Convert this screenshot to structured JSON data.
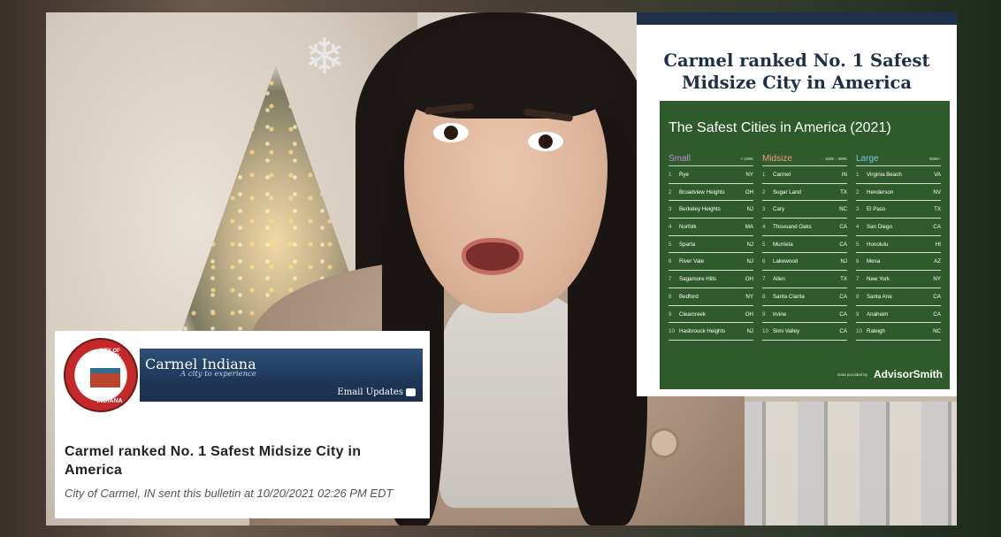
{
  "right_card": {
    "headline_line1": "Carmel ranked No. 1 Safest",
    "headline_line2": "Midsize City in America",
    "chart_title": "The Safest Cities in America (2021)",
    "columns": [
      {
        "name": "Small",
        "range": "< 100K",
        "rows": [
          {
            "rank": "1",
            "city": "Rye",
            "state": "NY"
          },
          {
            "rank": "2",
            "city": "Broadview Heights",
            "state": "OH"
          },
          {
            "rank": "3",
            "city": "Berkeley Heights",
            "state": "NJ"
          },
          {
            "rank": "4",
            "city": "Norfolk",
            "state": "MA"
          },
          {
            "rank": "5",
            "city": "Sparta",
            "state": "NJ"
          },
          {
            "rank": "6",
            "city": "River Vale",
            "state": "NJ"
          },
          {
            "rank": "7",
            "city": "Sagamore Hills",
            "state": "OH"
          },
          {
            "rank": "8",
            "city": "Bedford",
            "state": "NY"
          },
          {
            "rank": "9",
            "city": "Clearcreek",
            "state": "OH"
          },
          {
            "rank": "10",
            "city": "Hasbrouck Heights",
            "state": "NJ"
          }
        ]
      },
      {
        "name": "Midsize",
        "range": "100K - 300K",
        "rows": [
          {
            "rank": "1",
            "city": "Carmel",
            "state": "IN"
          },
          {
            "rank": "2",
            "city": "Sugar Land",
            "state": "TX"
          },
          {
            "rank": "3",
            "city": "Cary",
            "state": "NC"
          },
          {
            "rank": "4",
            "city": "Thousand Oaks",
            "state": "CA"
          },
          {
            "rank": "5",
            "city": "Murrieta",
            "state": "CA"
          },
          {
            "rank": "6",
            "city": "Lakewood",
            "state": "NJ"
          },
          {
            "rank": "7",
            "city": "Allen",
            "state": "TX"
          },
          {
            "rank": "8",
            "city": "Santa Clarita",
            "state": "CA"
          },
          {
            "rank": "9",
            "city": "Irvine",
            "state": "CA"
          },
          {
            "rank": "10",
            "city": "Simi Valley",
            "state": "CA"
          }
        ]
      },
      {
        "name": "Large",
        "range": "300K+",
        "rows": [
          {
            "rank": "1",
            "city": "Virginia Beach",
            "state": "VA"
          },
          {
            "rank": "2",
            "city": "Henderson",
            "state": "NV"
          },
          {
            "rank": "3",
            "city": "El Paso",
            "state": "TX"
          },
          {
            "rank": "4",
            "city": "San Diego",
            "state": "CA"
          },
          {
            "rank": "5",
            "city": "Honolulu",
            "state": "HI"
          },
          {
            "rank": "6",
            "city": "Mesa",
            "state": "AZ"
          },
          {
            "rank": "7",
            "city": "New York",
            "state": "NY"
          },
          {
            "rank": "8",
            "city": "Santa Ana",
            "state": "CA"
          },
          {
            "rank": "9",
            "city": "Anaheim",
            "state": "CA"
          },
          {
            "rank": "10",
            "city": "Raleigh",
            "state": "NC"
          }
        ]
      }
    ],
    "footer_small": "Data provided by",
    "footer_brand": "AdvisorSmith"
  },
  "left_card": {
    "seal_top": "CITY OF CARMEL",
    "seal_bottom": "INDIANA",
    "site_name": "Carmel Indiana",
    "tagline": "A city to experience",
    "email_updates": "Email Updates",
    "bulletin_title": "Carmel ranked No. 1 Safest Midsize City in America",
    "bulletin_meta": "City of Carmel, IN sent this bulletin at 10/20/2021 02:26 PM EDT"
  },
  "colors": {
    "panel_green": "#2f5a2c",
    "headline_navy": "#1e2f47",
    "banner_blue": "#1f3a5d",
    "small_purple": "#b78be0",
    "midsize_salmon": "#f29a8c",
    "large_blue": "#7cc0e8"
  },
  "icons": [
    "snowflake-ornament-icon",
    "email-icon",
    "city-seal"
  ]
}
